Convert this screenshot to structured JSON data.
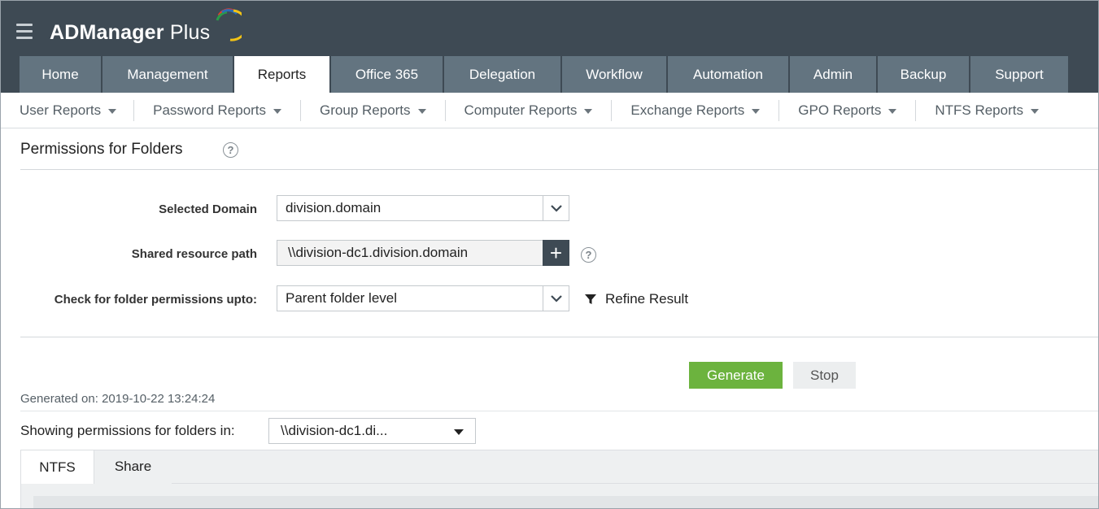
{
  "app": {
    "logo_text": "ADManager",
    "logo_plus": " Plus"
  },
  "tabs": [
    {
      "label": "Home",
      "active": false
    },
    {
      "label": "Management",
      "active": false
    },
    {
      "label": "Reports",
      "active": true
    },
    {
      "label": "Office 365",
      "active": false
    },
    {
      "label": "Delegation",
      "active": false
    },
    {
      "label": "Workflow",
      "active": false
    },
    {
      "label": "Automation",
      "active": false
    },
    {
      "label": "Admin",
      "active": false
    },
    {
      "label": "Backup",
      "active": false
    },
    {
      "label": "Support",
      "active": false
    }
  ],
  "subnav": [
    {
      "label": "User Reports"
    },
    {
      "label": "Password Reports"
    },
    {
      "label": "Group Reports"
    },
    {
      "label": "Computer Reports"
    },
    {
      "label": "Exchange Reports"
    },
    {
      "label": "GPO Reports"
    },
    {
      "label": "NTFS Reports"
    }
  ],
  "page": {
    "title": "Permissions for Folders",
    "help_glyph": "?"
  },
  "form": {
    "domain_label": "Selected Domain",
    "domain_value": "division.domain",
    "path_label": "Shared resource path",
    "path_value": "\\\\division-dc1.division.domain",
    "plus_glyph": "+",
    "level_label": "Check for folder permissions upto:",
    "level_value": "Parent folder level",
    "refine_label": "Refine Result"
  },
  "actions": {
    "generate": "Generate",
    "stop": "Stop"
  },
  "results": {
    "generated_on": "Generated on: 2019-10-22 13:24:24",
    "showing_label": "Showing permissions for folders in:",
    "folder_value": "\\\\division-dc1.di...",
    "tabs": [
      "NTFS",
      "Share"
    ]
  },
  "colors": {
    "header_bg": "#3e4a54",
    "tab_bg": "#637480",
    "generate_green": "#6cb33e"
  }
}
